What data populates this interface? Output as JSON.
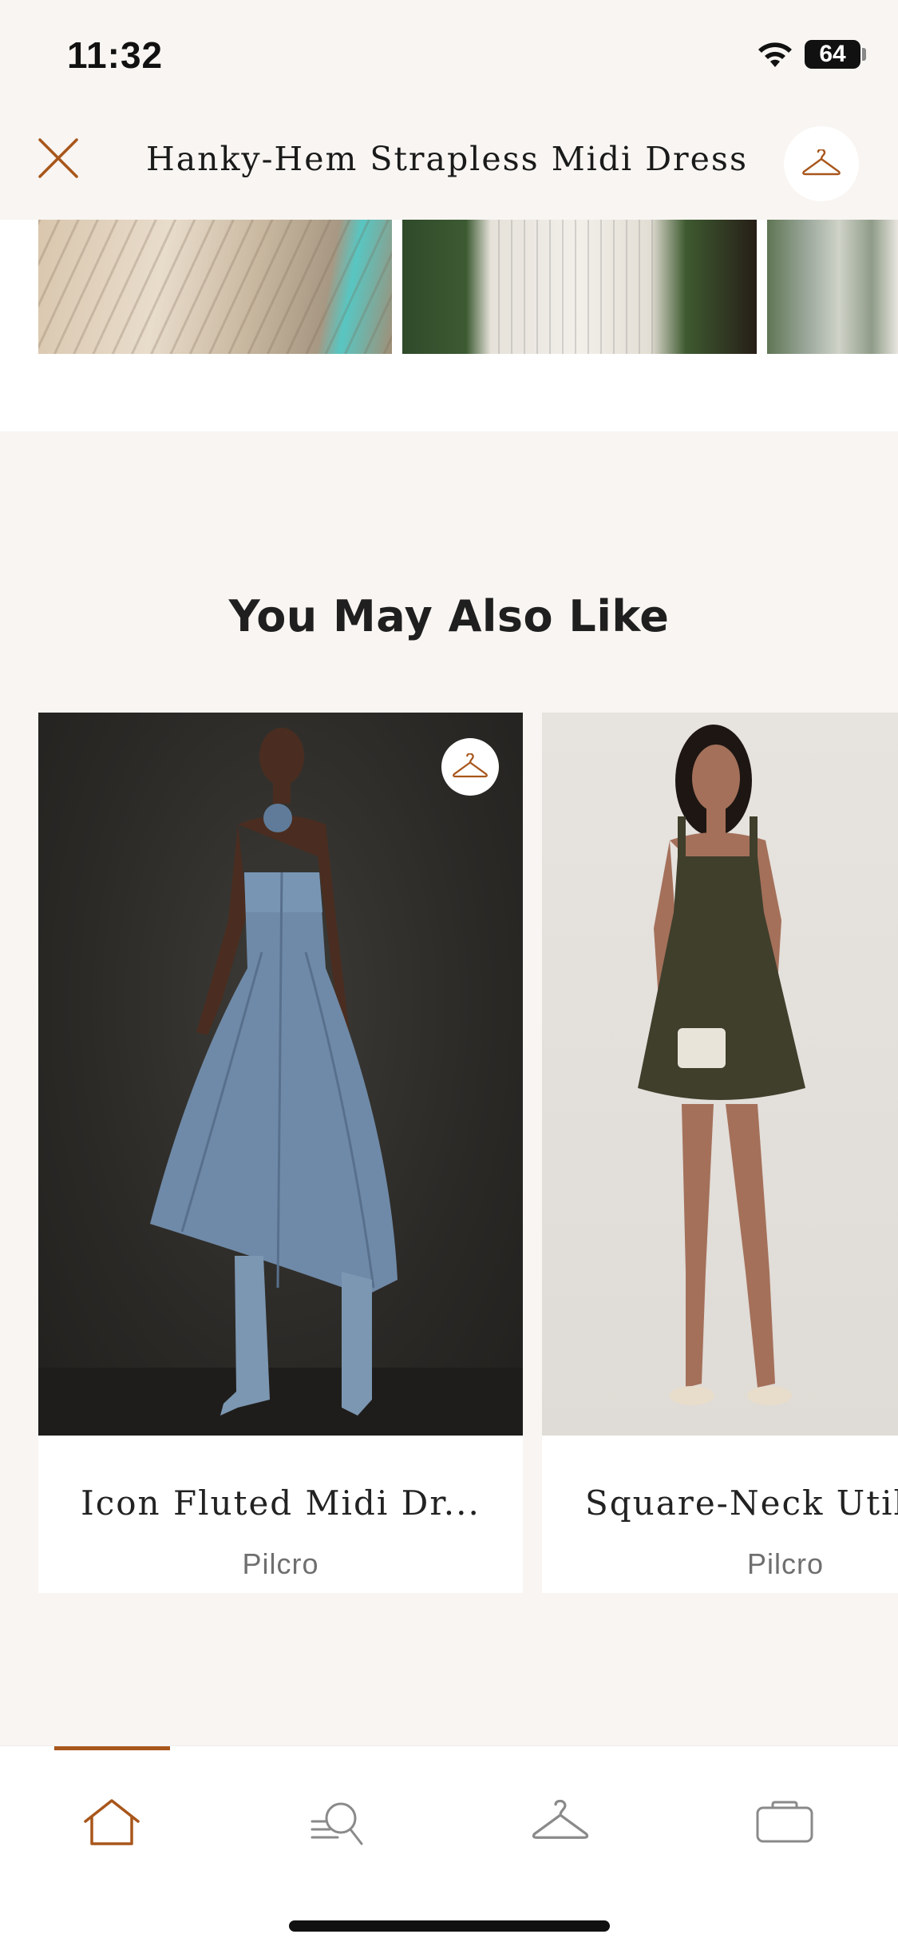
{
  "status_bar": {
    "time": "11:32",
    "battery": "64"
  },
  "header": {
    "title": "Hanky-Hem Strapless Midi Dress"
  },
  "recommendations": {
    "title": "You May Also Like",
    "products": [
      {
        "name": "Icon Fluted Midi Dr...",
        "brand": "Pilcro"
      },
      {
        "name": "Square-Neck Util",
        "brand": "Pilcro"
      }
    ]
  },
  "icons": {
    "close": "close-icon",
    "hanger": "hanger-icon",
    "home": "home-icon",
    "search": "search-icon",
    "closet": "hanger-icon",
    "bag": "bag-icon"
  },
  "colors": {
    "accent": "#a8561b",
    "background": "#f8f5f2",
    "text": "#1f1f1f"
  }
}
